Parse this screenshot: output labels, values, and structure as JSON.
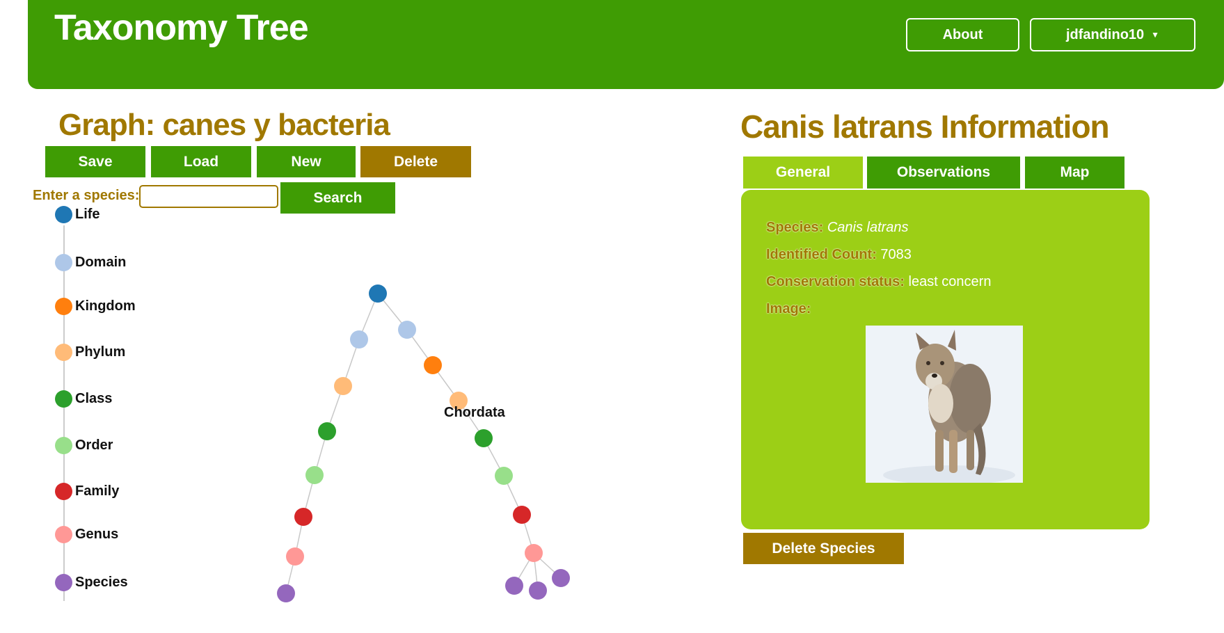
{
  "header": {
    "title": "Taxonomy Tree",
    "about_label": "About",
    "user_label": "jdfandino10",
    "caret": "▼"
  },
  "graph": {
    "title": "Graph: canes y bacteria",
    "buttons": {
      "save": "Save",
      "load": "Load",
      "new": "New",
      "delete": "Delete"
    },
    "species_label": "Enter a species:",
    "species_value": "",
    "search_label": "Search",
    "node_label": "Chordata"
  },
  "legend": [
    {
      "label": "Life",
      "color": "#1f77b4"
    },
    {
      "label": "Domain",
      "color": "#aec7e8"
    },
    {
      "label": "Kingdom",
      "color": "#ff7f0e"
    },
    {
      "label": "Phylum",
      "color": "#ffbb78"
    },
    {
      "label": "Class",
      "color": "#2ca02c"
    },
    {
      "label": "Order",
      "color": "#98df8a"
    },
    {
      "label": "Family",
      "color": "#d62728"
    },
    {
      "label": "Genus",
      "color": "#ff9896"
    },
    {
      "label": "Species",
      "color": "#9467bd"
    }
  ],
  "info": {
    "title": "Canis latrans Information",
    "tabs": [
      "General",
      "Observations",
      "Map"
    ],
    "active_tab": "General",
    "fields": {
      "species_label": "Species:",
      "species_value": "Canis latrans",
      "count_label": "Identified Count:",
      "count_value": "7083",
      "status_label": "Conservation status:",
      "status_value": "least concern",
      "image_label": "Image:"
    },
    "delete_species": "Delete Species"
  },
  "colors": {
    "header_green": "#3f9c04",
    "panel_green": "#9ccf16",
    "accent_brown": "#a07800"
  }
}
